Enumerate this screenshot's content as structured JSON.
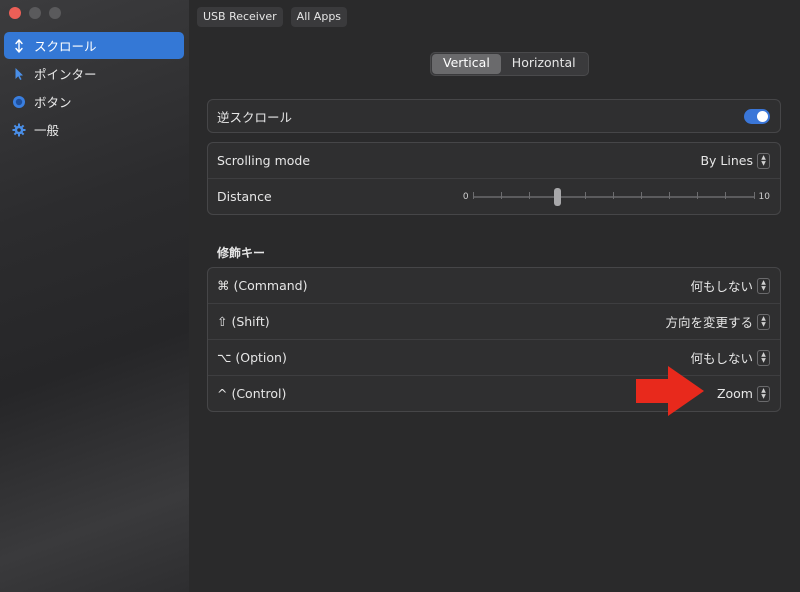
{
  "sidebar": {
    "items": [
      {
        "label": "スクロール",
        "icon": "vertical-arrows-icon",
        "active": true
      },
      {
        "label": "ポインター",
        "icon": "pointer-cursor-icon",
        "active": false
      },
      {
        "label": "ボタン",
        "icon": "radio-button-icon",
        "active": false
      },
      {
        "label": "一般",
        "icon": "gear-icon",
        "active": false
      }
    ]
  },
  "topbar": {
    "device": "USB Receiver",
    "apps": "All Apps"
  },
  "direction_tabs": {
    "vertical": "Vertical",
    "horizontal": "Horizontal",
    "selected": "Vertical"
  },
  "reverse_scroll": {
    "label": "逆スクロール",
    "enabled": true
  },
  "scrolling": {
    "mode_label": "Scrolling mode",
    "mode_value": "By Lines",
    "distance_label": "Distance",
    "distance_min": "0",
    "distance_max": "10",
    "distance_value": 3
  },
  "modifiers": {
    "title": "修飾キー",
    "rows": [
      {
        "key": "⌘ (Command)",
        "action": "何もしない"
      },
      {
        "key": "⇧ (Shift)",
        "action": "方向を変更する"
      },
      {
        "key": "⌥ (Option)",
        "action": "何もしない"
      },
      {
        "key": "^ (Control)",
        "action": "Zoom"
      }
    ]
  },
  "colors": {
    "accent": "#3478d6",
    "annotation_arrow": "#e8291c"
  }
}
